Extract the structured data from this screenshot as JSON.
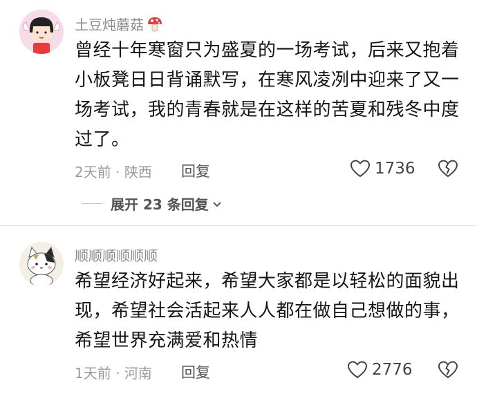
{
  "comments": [
    {
      "username": "土豆炖蘑菇",
      "username_emoji": "mushroom-icon",
      "lines": [
        "曾经十年寒窗只为盛夏的一场考试，后来又抱着",
        "小板凳日日背诵默写，在寒风凌冽中迎来了又一",
        "场考试，我的青春就是在这样的苦夏和残冬中度",
        "过了。"
      ],
      "time": "2天前",
      "location": "陕西",
      "separator": "·",
      "reply_label": "回复",
      "likes": "1736",
      "expand_label": "展开 23 条回复"
    },
    {
      "username": "顺顺顺顺顺顺",
      "lines": [
        "希望经济好起来，希望大家都是以轻松的面貌出",
        "现，希望社会活起来人人都在做自己想做的事，",
        "希望世界充满爱和热情"
      ],
      "time": "1天前",
      "location": "河南",
      "separator": "·",
      "reply_label": "回复",
      "likes": "2776"
    }
  ],
  "colors": {
    "username": "#8a8a8a",
    "content": "#151515",
    "meta": "#9a9a9a",
    "avatar1_bg": "#f6dce8",
    "avatar2_bg": "#f3efe6"
  }
}
